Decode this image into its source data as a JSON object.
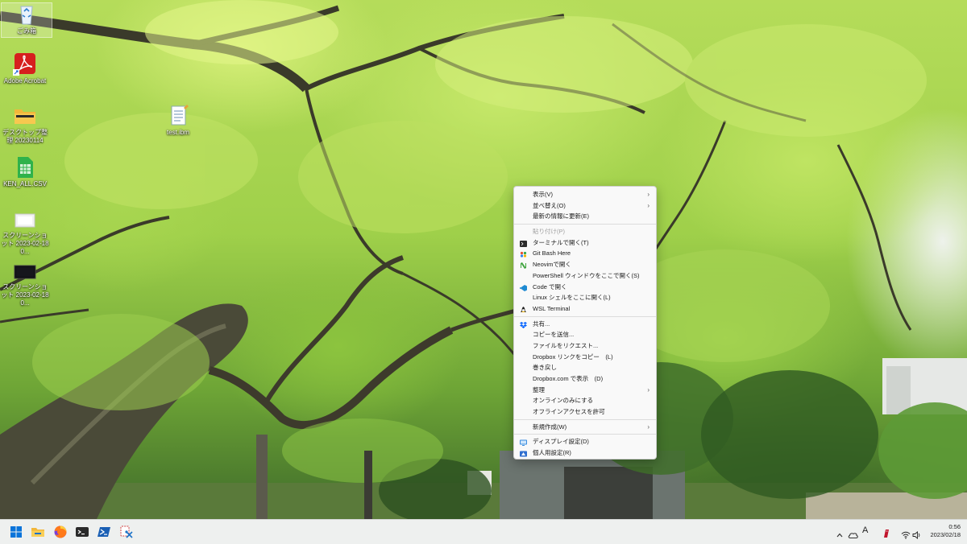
{
  "desktop": {
    "icons": [
      {
        "label": "ごみ箱",
        "icon": "recycle-bin-icon"
      },
      {
        "label": "Adobe Acrobat",
        "icon": "adobe-acrobat-icon"
      },
      {
        "label": "デスクトップ整理 20230114",
        "icon": "folder-icon"
      },
      {
        "label": "test.ibm",
        "icon": "notepad-file-icon"
      },
      {
        "label": "KEN_ALL.CSV",
        "icon": "csv-file-icon"
      },
      {
        "label": "スクリーンショット 2023-02-18 0...",
        "icon": "screenshot-file-icon"
      },
      {
        "label": "スクリーンショット 2023-02-18 0...",
        "icon": "screenshot-file-icon"
      }
    ]
  },
  "context_menu": {
    "items": [
      {
        "label": "表示(V)",
        "submenu": true
      },
      {
        "label": "並べ替え(O)",
        "submenu": true
      },
      {
        "label": "最新の情報に更新(E)"
      },
      {
        "separator": true
      },
      {
        "label": "貼り付け(P)",
        "disabled": true
      },
      {
        "label": "ターミナルで開く(T)",
        "icon": "terminal-icon"
      },
      {
        "label": "Git Bash Here",
        "icon": "git-bash-icon"
      },
      {
        "label": "Neovimで開く",
        "icon": "neovim-icon"
      },
      {
        "label": "PowerShell ウィンドウをここで開く(S)"
      },
      {
        "label": "Code で開く",
        "icon": "vscode-icon"
      },
      {
        "label": "Linux シェルをここに開く(L)"
      },
      {
        "label": "WSL Terminal",
        "icon": "wsl-terminal-icon"
      },
      {
        "separator": true
      },
      {
        "label": "共有...",
        "icon": "dropbox-icon"
      },
      {
        "label": "コピーを送信..."
      },
      {
        "label": "ファイルをリクエスト..."
      },
      {
        "label": "Dropbox リンクをコピー　(L)"
      },
      {
        "label": "巻き戻し"
      },
      {
        "label": "Dropbox.com で表示　(D)"
      },
      {
        "label": "整理",
        "submenu": true
      },
      {
        "label": "オンラインのみにする"
      },
      {
        "label": "オフラインアクセスを許可"
      },
      {
        "separator": true
      },
      {
        "label": "新規作成(W)",
        "submenu": true
      },
      {
        "separator": true
      },
      {
        "label": "ディスプレイ設定(D)",
        "icon": "display-icon"
      },
      {
        "label": "個人用設定(R)",
        "icon": "personalize-icon"
      }
    ]
  },
  "taskbar": {
    "apps": [
      "windows-start-icon",
      "file-explorer-icon",
      "firefox-icon",
      "terminal-icon",
      "powershell-icon",
      "snipping-tool-icon"
    ],
    "tray_icons": [
      "chevron-up-icon",
      "onedrive-icon",
      "ime-icon",
      "app-tray-icon",
      "wifi-icon",
      "speaker-icon"
    ],
    "ime_label": "A",
    "time": "0:56",
    "date": "2023/02/18"
  },
  "colors": {
    "accent": "#0067c0",
    "menu_bg": "#f9f9f9",
    "taskbar_bg": "#eef0ef"
  }
}
